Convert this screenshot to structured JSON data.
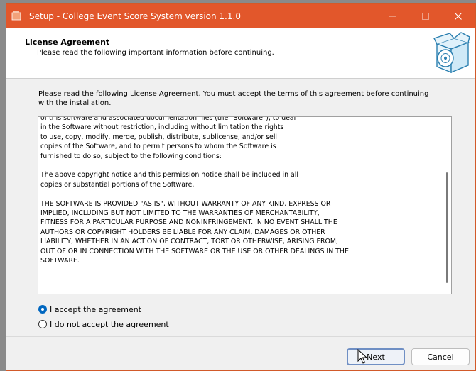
{
  "window": {
    "title": "Setup - College Event Score System version 1.1.0"
  },
  "header": {
    "title": "License Agreement",
    "subtitle": "Please read the following important information before continuing."
  },
  "intro": "Please read the following License Agreement. You must accept the terms of this agreement before continuing with the installation.",
  "license": {
    "paragraphs": [
      "of this software and associated documentation files (the \"Software\"), to deal\nin the Software without restriction, including without limitation the rights\nto use, copy, modify, merge, publish, distribute, sublicense, and/or sell\ncopies of the Software, and to permit persons to whom the Software is\nfurnished to do so, subject to the following conditions:",
      "The above copyright notice and this permission notice shall be included in all\ncopies or substantial portions of the Software.",
      "THE SOFTWARE IS PROVIDED \"AS IS\", WITHOUT WARRANTY OF ANY KIND, EXPRESS OR\nIMPLIED, INCLUDING BUT NOT LIMITED TO THE WARRANTIES OF MERCHANTABILITY,\nFITNESS FOR A PARTICULAR PURPOSE AND NONINFRINGEMENT. IN NO EVENT SHALL THE\nAUTHORS OR COPYRIGHT HOLDERS BE LIABLE FOR ANY CLAIM, DAMAGES OR OTHER\nLIABILITY, WHETHER IN AN ACTION OF CONTRACT, TORT OR OTHERWISE, ARISING FROM,\nOUT OF OR IN CONNECTION WITH THE SOFTWARE OR THE USE OR OTHER DEALINGS IN THE\nSOFTWARE."
    ]
  },
  "options": {
    "accept_label": "I accept the agreement",
    "decline_label": "I do not accept the agreement",
    "selected": "accept"
  },
  "buttons": {
    "next_label": "Next",
    "cancel_label": "Cancel"
  },
  "colors": {
    "titlebar": "#e2572b",
    "accent": "#0067c0"
  },
  "icons": {
    "app": "app-icon",
    "minimize": "minimize-icon",
    "maximize": "maximize-icon",
    "close": "close-icon",
    "header_graphic": "install-box-icon",
    "cursor": "mouse-cursor-icon"
  }
}
